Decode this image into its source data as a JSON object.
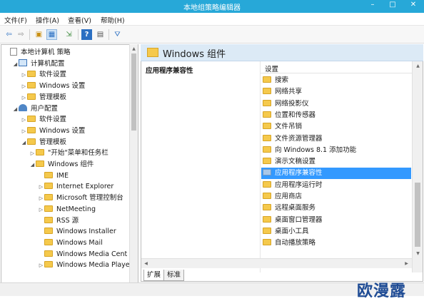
{
  "window": {
    "title": "本地组策略编辑器",
    "minimize_glyph": "–",
    "maximize_glyph": "□",
    "close_glyph": "✕"
  },
  "menu": [
    "文件(F)",
    "操作(A)",
    "查看(V)",
    "帮助(H)"
  ],
  "toolbar": {
    "icons": [
      "back-arrow-icon",
      "forward-arrow-icon",
      "up-folder-icon",
      "show-hide-tree-icon",
      "export-list-icon",
      "help-icon",
      "properties-icon",
      "filter-icon"
    ],
    "glyphs": [
      "⇦",
      "⇨",
      "▣",
      "▦",
      "⇲",
      "?",
      "▤",
      "⛛"
    ]
  },
  "tree": {
    "rows": [
      {
        "label": "本地计算机 策略",
        "indent": 0,
        "arrow": "",
        "icon": "doc"
      },
      {
        "label": "计算机配置",
        "indent": 1,
        "arrow": "◢",
        "icon": "computer"
      },
      {
        "label": "软件设置",
        "indent": 2,
        "arrow": "▷",
        "icon": "folder"
      },
      {
        "label": "Windows 设置",
        "indent": 2,
        "arrow": "▷",
        "icon": "folder"
      },
      {
        "label": "管理模板",
        "indent": 2,
        "arrow": "▷",
        "icon": "folder"
      },
      {
        "label": "用户配置",
        "indent": 1,
        "arrow": "◢",
        "icon": "user"
      },
      {
        "label": "软件设置",
        "indent": 2,
        "arrow": "▷",
        "icon": "folder"
      },
      {
        "label": "Windows 设置",
        "indent": 2,
        "arrow": "▷",
        "icon": "folder"
      },
      {
        "label": "管理模板",
        "indent": 2,
        "arrow": "◢",
        "icon": "folder"
      },
      {
        "label": "\"开始\"菜单和任务栏",
        "indent": 3,
        "arrow": "▷",
        "icon": "folder"
      },
      {
        "label": "Windows 组件",
        "indent": 3,
        "arrow": "◢",
        "icon": "folder"
      },
      {
        "label": "IME",
        "indent": 4,
        "arrow": "",
        "icon": "folder"
      },
      {
        "label": "Internet Explorer",
        "indent": 4,
        "arrow": "▷",
        "icon": "folder"
      },
      {
        "label": "Microsoft 管理控制台",
        "indent": 4,
        "arrow": "▷",
        "icon": "folder"
      },
      {
        "label": "NetMeeting",
        "indent": 4,
        "arrow": "▷",
        "icon": "folder"
      },
      {
        "label": "RSS 源",
        "indent": 4,
        "arrow": "",
        "icon": "folder"
      },
      {
        "label": "Windows Installer",
        "indent": 4,
        "arrow": "",
        "icon": "folder"
      },
      {
        "label": "Windows Mail",
        "indent": 4,
        "arrow": "",
        "icon": "folder"
      },
      {
        "label": "Windows Media Cent",
        "indent": 4,
        "arrow": "",
        "icon": "folder"
      },
      {
        "label": "Windows Media Playe",
        "indent": 4,
        "arrow": "▷",
        "icon": "folder"
      }
    ]
  },
  "right_pane": {
    "header_title": "Windows 组件",
    "description_title": "应用程序兼容性",
    "column_header": "设置",
    "items": [
      {
        "label": "搜索",
        "selected": false
      },
      {
        "label": "网络共享",
        "selected": false
      },
      {
        "label": "网络投影仪",
        "selected": false
      },
      {
        "label": "位置和传感器",
        "selected": false
      },
      {
        "label": "文件吊销",
        "selected": false
      },
      {
        "label": "文件资源管理器",
        "selected": false
      },
      {
        "label": "向 Windows 8.1 添加功能",
        "selected": false
      },
      {
        "label": "演示文稿设置",
        "selected": false
      },
      {
        "label": "应用程序兼容性",
        "selected": true
      },
      {
        "label": "应用程序运行时",
        "selected": false
      },
      {
        "label": "应用商店",
        "selected": false
      },
      {
        "label": "远程桌面服务",
        "selected": false
      },
      {
        "label": "桌面窗口管理器",
        "selected": false
      },
      {
        "label": "桌面小工具",
        "selected": false
      },
      {
        "label": "自动播放策略",
        "selected": false
      }
    ]
  },
  "tabs": [
    {
      "label": "扩展",
      "active": true
    },
    {
      "label": "标准",
      "active": false
    }
  ],
  "scroll_glyphs": {
    "up": "▲",
    "down": "▼",
    "left": "◀",
    "right": "▶"
  },
  "watermark": "欧漫露",
  "colors": {
    "titlebar": "#27a8d8",
    "selection": "#3399ff",
    "header": "#dceaf6"
  }
}
